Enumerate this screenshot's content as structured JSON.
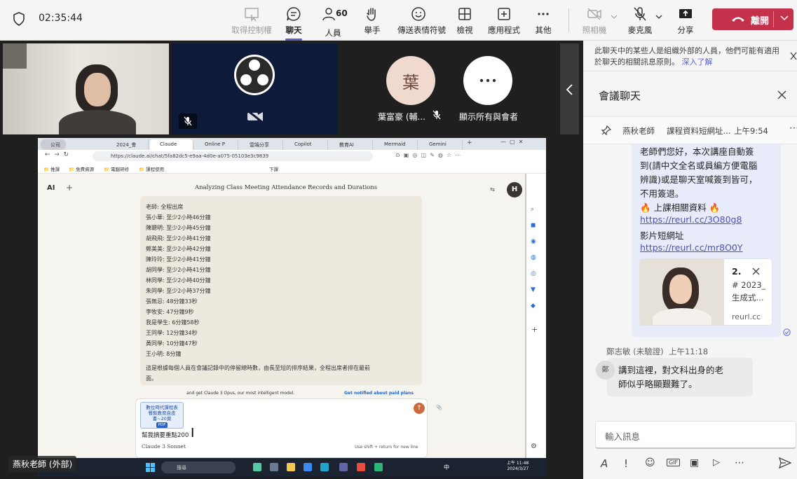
{
  "toolbar": {
    "time": "02:35:44",
    "buttons": {
      "take_control": "取得控制權",
      "chat": "聊天",
      "people": "人員",
      "people_count": "60",
      "raise_hand": "舉手",
      "reactions": "傳送表情符號",
      "view": "檢視",
      "apps": "應用程式",
      "more": "其他",
      "camera": "照相機",
      "mic": "麥克風",
      "share": "分享"
    },
    "leave_label": "離開",
    "colors": {
      "leave": "#c4314b",
      "accent": "#5b5fc7"
    }
  },
  "participants": {
    "avatar_char": "葉",
    "avatar_name": "葉富豪 (輔...",
    "show_all_label": "顯示所有與會者",
    "presenter_label": "燕秋老師 (外部)"
  },
  "shared_screen": {
    "tabs": [
      "公司",
      "2024_會",
      "Claude",
      "Online P",
      "雲端分享",
      "Copilot",
      "教育AI",
      "Mermaid",
      "Gemini"
    ],
    "url": "https://claude.ai/chat/5fa82dc5-e9aa-4d0e-a075-05103e3c9839",
    "bookmarks": [
      "推課",
      "免費資源",
      "電腦研修",
      "課程使用",
      "下課"
    ],
    "claude": {
      "title": "Analyzing Class Meeting Attendance Records and Durations",
      "lines": [
        "老師: 全程出席",
        "張小華: 至少2小時46分鐘",
        "陳聰明: 至少2小時45分鐘",
        "胡飛飛: 至少2小時41分鐘",
        "鄭美美: 至少2小時42分鐘",
        "陳玲玲: 至少2小時41分鐘",
        "胡同學: 至少2小時41分鐘",
        "林同學: 至少2小時40分鐘",
        "朱同學: 至少2小時37分鐘",
        "張無忌: 48分鐘33秒",
        "李牧安: 47分鐘9秒",
        "我是學生: 6分鐘58秒",
        "王同學: 12分鐘34秒",
        "黃同學: 10分鐘47秒",
        "王小明: 8分鐘"
      ],
      "summary_1": "這是根據每個人員在會議記錄中的停留總時數，由長至短的排序結果，全程出席者排在最前",
      "summary_2": "面。",
      "promo": "and get Claude 3 Opus, our most intelligent model.",
      "promo_link": "Get notified about paid plans",
      "pdf_card": [
        "數位時代課程表",
        "餐飲教育自皮",
        "書~20頁"
      ],
      "pdf_tag": "PDF",
      "input_text": "幫我摘要重點200",
      "model": "Claude 3 Sonnet",
      "hint": "Use shift + return for new line",
      "avatar": "H"
    },
    "taskbar": {
      "search": "搜尋",
      "lang": "中",
      "time": "上午 11:48",
      "date": "2024/3/27"
    }
  },
  "chat": {
    "banner": "此聊天中的某些人是組織外部的人員，他們可能有適用於聊天的相關訊息原則。",
    "banner_link": "深入了解",
    "title": "會議聊天",
    "pinned_sender": "燕秋老師",
    "pinned_text": "課程資料短網址...",
    "pinned_time": "上午9:54",
    "my_message": {
      "lines": [
        "老師們您好，本次講座自動簽",
        "到(請中文全名或員編方便電腦",
        "辨識)或是聊天室喊簽到皆可，",
        "不用簽退。"
      ],
      "materials": "上課相關資料",
      "link1": "https://reurl.cc/3O80g8",
      "video_label": "影片短網址",
      "link2": "https://reurl.cc/mr8O0Y",
      "card_title": "2.",
      "card_sub1": "# 2023_",
      "card_sub2": "生成式...",
      "card_domain": "reurl.cc"
    },
    "other_sender": "鄭志敏 (未驗證)",
    "other_time": "上午11:18",
    "other_avatar": "鄭",
    "other_message": [
      "講到這裡，對文科出身的老",
      "師似乎略顯艱難了。"
    ],
    "compose_placeholder": "輸入訊息"
  }
}
